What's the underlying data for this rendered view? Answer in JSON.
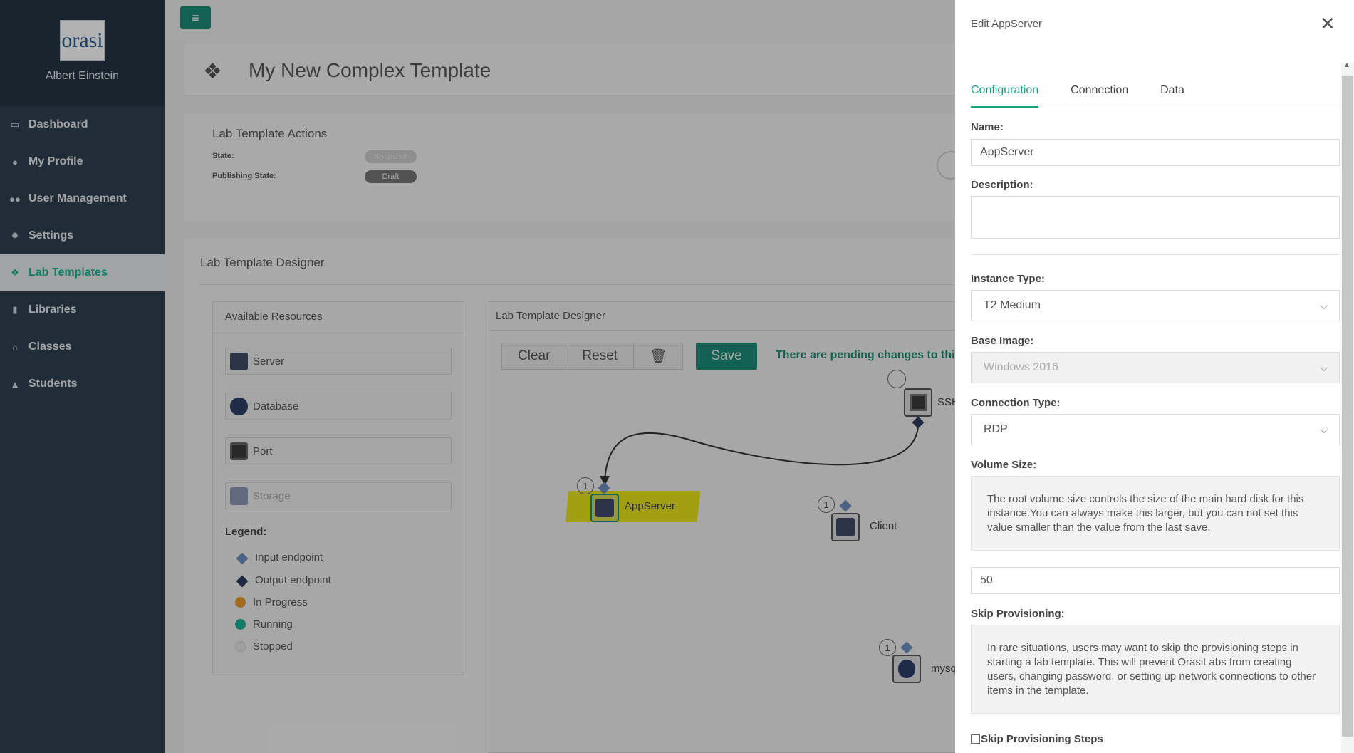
{
  "sidebar": {
    "logo_text": "orasi",
    "username": "Albert Einstein",
    "items": [
      {
        "label": "Dashboard",
        "icon": "monitor-icon"
      },
      {
        "label": "My Profile",
        "icon": "user-icon"
      },
      {
        "label": "User Management",
        "icon": "users-icon"
      },
      {
        "label": "Settings",
        "icon": "gear-icon"
      },
      {
        "label": "Lab Templates",
        "icon": "cubes-icon"
      },
      {
        "label": "Libraries",
        "icon": "book-icon"
      },
      {
        "label": "Classes",
        "icon": "bank-icon"
      },
      {
        "label": "Students",
        "icon": "graduation-cap-icon"
      }
    ],
    "active_index": 4
  },
  "header": {
    "title": "My New Complex Template"
  },
  "actions": {
    "title": "Lab Template Actions",
    "state_label": "State:",
    "state_value": "Snapshot",
    "publishing_label": "Publishing State:",
    "publishing_value": "Draft"
  },
  "designer": {
    "section_title": "Lab Template Designer",
    "resources": {
      "title": "Available Resources",
      "items": [
        "Server",
        "Database",
        "Port",
        "Storage"
      ],
      "legend_title": "Legend:",
      "legend": [
        "Input endpoint",
        "Output endpoint",
        "In Progress",
        "Running",
        "Stopped"
      ]
    },
    "canvas": {
      "title": "Lab Template Designer",
      "clear_label": "Clear",
      "reset_label": "Reset",
      "save_label": "Save",
      "pending_text": "There are pending changes to this",
      "nodes": {
        "appserver": {
          "label": "AppServer",
          "count": "1"
        },
        "client": {
          "label": "Client",
          "count": "1"
        },
        "ssh": {
          "label": "SSH"
        },
        "mysql": {
          "label": "mysq",
          "count": "1"
        }
      }
    }
  },
  "edit_panel": {
    "title": "Edit AppServer",
    "tabs": [
      "Configuration",
      "Connection",
      "Data"
    ],
    "name_label": "Name:",
    "name_value": "AppServer",
    "description_label": "Description:",
    "instance_type_label": "Instance Type:",
    "instance_type_value": "T2 Medium",
    "base_image_label": "Base Image:",
    "base_image_value": "Windows 2016",
    "connection_type_label": "Connection Type:",
    "connection_type_value": "RDP",
    "volume_size_label": "Volume Size:",
    "volume_info": "The root volume size controls the size of the main hard disk for this instance.You can always make this larger, but you can not set this value smaller than the value from the last save.",
    "volume_value": "50",
    "skip_label": "Skip Provisioning:",
    "skip_info": "In rare situations, users may want to skip the provisioning steps in starting a lab template. This will prevent OrasiLabs from creating users, changing password, or setting up network connections to other items in the template.",
    "skip_checkbox_label": "Skip Provisioning Steps"
  },
  "colors": {
    "sidebar": "#2f4050",
    "accent": "#1ab394",
    "save": "#1a8c76",
    "highlight": "#e8e21a"
  }
}
